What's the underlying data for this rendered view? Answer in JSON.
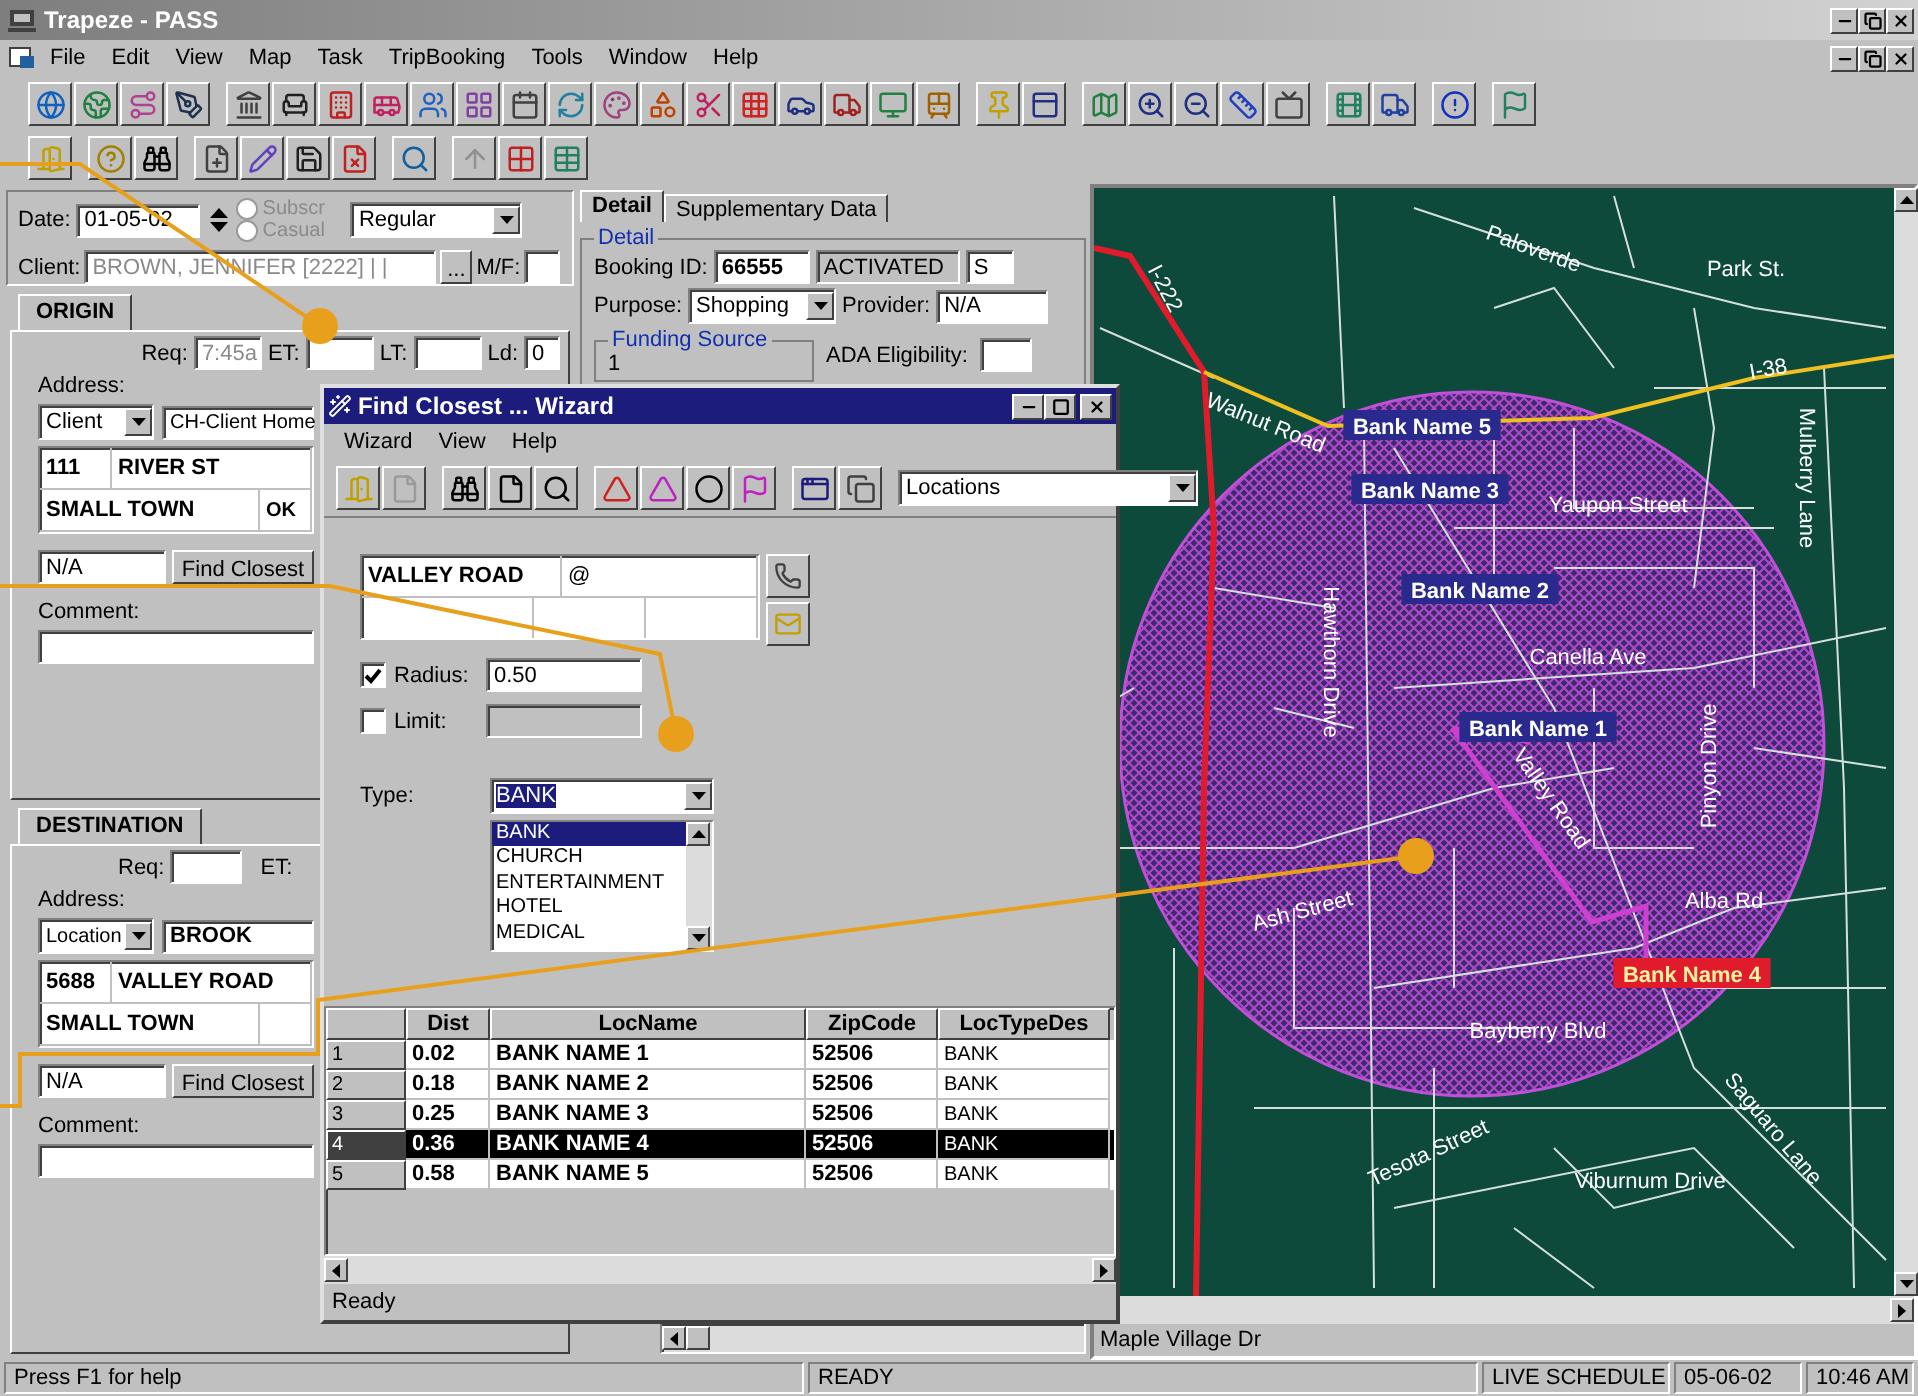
{
  "window": {
    "title": "Trapeze - PASS"
  },
  "menu": [
    "File",
    "Edit",
    "View",
    "Map",
    "Task",
    "TripBooking",
    "Tools",
    "Window",
    "Help"
  ],
  "booking": {
    "date_label": "Date:",
    "date": "01-05-02",
    "radios": [
      {
        "label": "Subscr",
        "selected": false,
        "disabled": true
      },
      {
        "label": "Casual",
        "selected": false,
        "disabled": true
      }
    ],
    "trip_type": "Regular",
    "client_label": "Client:",
    "client": "BROWN, JENNIFER [2222] | |",
    "browse_button": "...",
    "mf_label": "M/F:"
  },
  "origin": {
    "tab": "ORIGIN",
    "req_label": "Req:",
    "req": "7:45a",
    "et_label": "ET:",
    "lt_label": "LT:",
    "ld_label": "Ld:",
    "ld": "0",
    "address_label": "Address:",
    "address_type": "Client",
    "address_name": "CH-Client Home",
    "number": "111",
    "street": "RIVER ST",
    "city": "SMALL TOWN",
    "state": "OK",
    "phone": "N/A",
    "find_button": "Find Closest",
    "comment_label": "Comment:"
  },
  "destination": {
    "tab": "DESTINATION",
    "req_label": "Req:",
    "et_label": "ET:",
    "address_label": "Address:",
    "address_type": "Location",
    "address_name": "BROOK",
    "number": "5688",
    "street": "VALLEY ROAD",
    "city": "SMALL TOWN",
    "phone": "N/A",
    "find_button": "Find Closest",
    "comment_label": "Comment:"
  },
  "detail": {
    "tabs": [
      {
        "label": "Detail",
        "selected": true
      },
      {
        "label": "Supplementary Data",
        "selected": false
      }
    ],
    "group": "Detail",
    "booking_id_label": "Booking ID:",
    "booking_id": "66555",
    "status": "ACTIVATED",
    "column_3": "S",
    "purpose_label": "Purpose:",
    "purpose": "Shopping",
    "provider_label": "Provider:",
    "provider": "N/A",
    "funding_label": "Funding Source",
    "funding_row": "1",
    "ada_label": "ADA Eligibility:"
  },
  "map": {
    "labels": [
      {
        "text": "Paloverde",
        "kind": "street"
      },
      {
        "text": "Park St.",
        "kind": "street"
      },
      {
        "text": "I-222",
        "kind": "street"
      },
      {
        "text": "I-38",
        "kind": "street"
      },
      {
        "text": "Walnut Road",
        "kind": "street"
      },
      {
        "text": "Mulberry Lane",
        "kind": "street"
      },
      {
        "text": "Bank Name 5",
        "kind": "bank",
        "selected": false
      },
      {
        "text": "Bank Name 3",
        "kind": "bank",
        "selected": false
      },
      {
        "text": "Yaupon Street",
        "kind": "street"
      },
      {
        "text": "Hawthorn Drive",
        "kind": "street"
      },
      {
        "text": "Bank Name 2",
        "kind": "bank",
        "selected": false
      },
      {
        "text": "Canella Ave",
        "kind": "street"
      },
      {
        "text": "Bank Name 1",
        "kind": "bank",
        "selected": false
      },
      {
        "text": "Valley Road",
        "kind": "street"
      },
      {
        "text": "Pinyon Drive",
        "kind": "street"
      },
      {
        "text": "Ash Street",
        "kind": "street"
      },
      {
        "text": "Alba Rd",
        "kind": "street"
      },
      {
        "text": "Bank Name 4",
        "kind": "bank",
        "selected": true
      },
      {
        "text": "Bayberry Blvd",
        "kind": "street"
      },
      {
        "text": "Tesota Street",
        "kind": "street"
      },
      {
        "text": "Saguaro Lane",
        "kind": "street"
      },
      {
        "text": "Viburnum Drive",
        "kind": "street"
      }
    ],
    "status": "Maple Village Dr"
  },
  "wizard": {
    "title": "Find Closest ... Wizard",
    "menu": [
      "Wizard",
      "View",
      "Help"
    ],
    "source": "Locations",
    "address": {
      "street": "VALLEY ROAD",
      "cross": "@"
    },
    "radius": {
      "label": "Radius:",
      "checked": true,
      "value": "0.50"
    },
    "limit": {
      "label": "Limit:",
      "checked": false
    },
    "type_label": "Type:",
    "type": "BANK",
    "type_options": [
      {
        "label": "BANK",
        "selected": true
      },
      {
        "label": "CHURCH",
        "selected": false
      },
      {
        "label": "ENTERTAINMENT",
        "selected": false
      },
      {
        "label": "HOTEL",
        "selected": false
      },
      {
        "label": "MEDICAL",
        "selected": false
      }
    ],
    "table": {
      "columns": [
        "Dist",
        "LocName",
        "ZipCode",
        "LocTypeDes"
      ],
      "rows": [
        {
          "index": "1",
          "dist": "0.02",
          "name": "BANK NAME 1",
          "zip": "52506",
          "type": "BANK",
          "selected": false
        },
        {
          "index": "2",
          "dist": "0.18",
          "name": "BANK NAME 2",
          "zip": "52506",
          "type": "BANK",
          "selected": false
        },
        {
          "index": "3",
          "dist": "0.25",
          "name": "BANK NAME 3",
          "zip": "52506",
          "type": "BANK",
          "selected": false
        },
        {
          "index": "4",
          "dist": "0.36",
          "name": "BANK NAME 4",
          "zip": "52506",
          "type": "BANK",
          "selected": true
        },
        {
          "index": "5",
          "dist": "0.58",
          "name": "BANK NAME 5",
          "zip": "52506",
          "type": "BANK",
          "selected": false
        }
      ]
    },
    "status": "Ready"
  },
  "status_bar": {
    "help": "Press F1 for help",
    "state": "READY",
    "mode": "LIVE SCHEDULE",
    "date": "05-06-02",
    "time": "10:46 AM"
  }
}
